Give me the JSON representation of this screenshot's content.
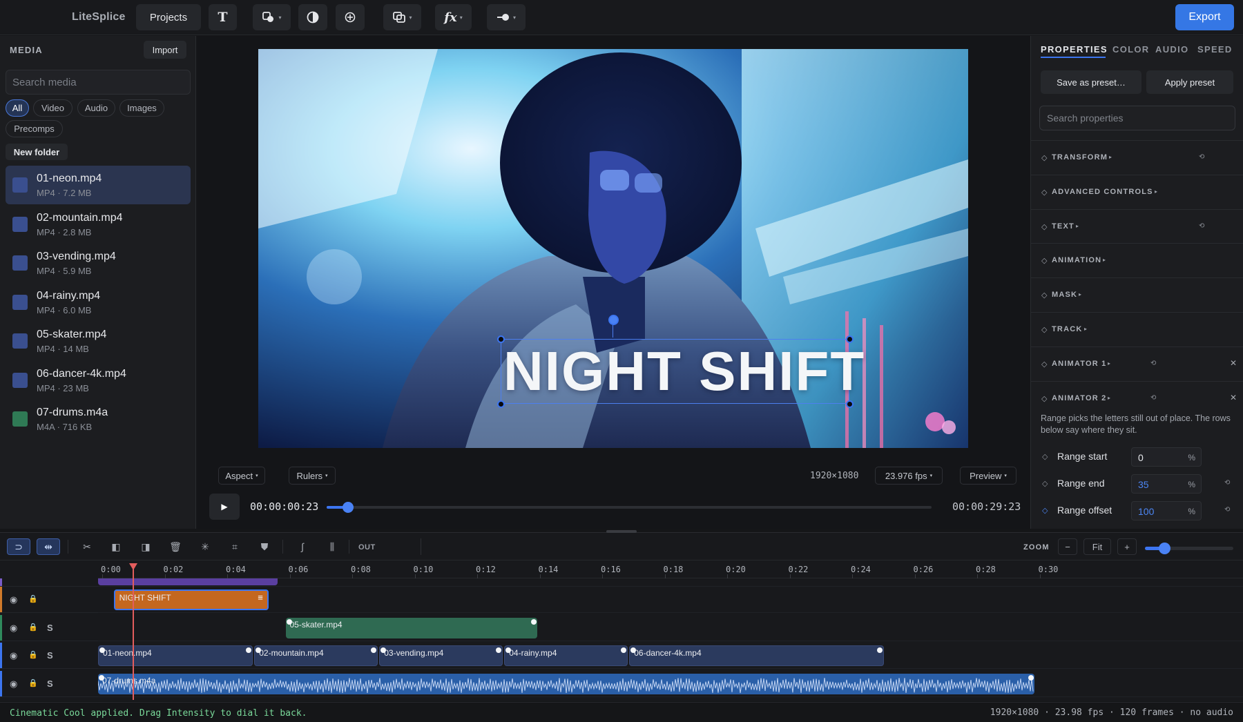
{
  "app": {
    "title": "LiteSplice"
  },
  "toolbar": {
    "projects_label": "Projects",
    "text_icon": "T",
    "fx_icon": "fx",
    "export_label": "Export"
  },
  "media": {
    "title": "MEDIA",
    "import_label": "Import",
    "search_placeholder": "Search media",
    "filters": [
      "All",
      "Video",
      "Audio",
      "Images",
      "Precomps"
    ],
    "active_filter": "All",
    "new_folder_label": "New folder",
    "items": [
      {
        "name": "01-neon.mp4",
        "meta": "MP4 · 7.2 MB",
        "color": "#3a4f8f"
      },
      {
        "name": "02-mountain.mp4",
        "meta": "MP4 · 2.8 MB",
        "color": "#3a4f8f"
      },
      {
        "name": "03-vending.mp4",
        "meta": "MP4 · 5.9 MB",
        "color": "#3a4f8f"
      },
      {
        "name": "04-rainy.mp4",
        "meta": "MP4 · 6.0 MB",
        "color": "#3a4f8f"
      },
      {
        "name": "05-skater.mp4",
        "meta": "MP4 · 14 MB",
        "color": "#3a4f8f"
      },
      {
        "name": "06-dancer-4k.mp4",
        "meta": "MP4 · 23 MB",
        "color": "#3a4f8f"
      },
      {
        "name": "07-drums.m4a",
        "meta": "M4A · 716 KB",
        "color": "#2f7a55"
      }
    ]
  },
  "viewer": {
    "overlay_text": "NIGHT SHIFT",
    "aspect_label": "Aspect",
    "rulers_label": "Rulers",
    "resolution": "1920×1080",
    "fps_label": "23.976 fps",
    "preview_label": "Preview",
    "timecode_current": "00:00:00:23",
    "timecode_total": "00:00:29:23",
    "scrub_progress": 0.035
  },
  "properties": {
    "tabs": [
      "PROPERTIES",
      "COLOR",
      "AUDIO",
      "SPEED"
    ],
    "active_tab": "PROPERTIES",
    "save_preset_label": "Save as preset…",
    "apply_preset_label": "Apply preset",
    "search_placeholder": "Search properties",
    "sections": [
      {
        "title": "TRANSFORM",
        "reset": true,
        "close": false
      },
      {
        "title": "ADVANCED CONTROLS",
        "reset": false,
        "close": false
      },
      {
        "title": "TEXT",
        "reset": true,
        "close": false
      },
      {
        "title": "ANIMATION",
        "reset": false,
        "close": false
      },
      {
        "title": "MASK",
        "reset": false,
        "close": false
      },
      {
        "title": "TRACK",
        "reset": false,
        "close": false
      },
      {
        "title": "ANIMATOR 1",
        "reset": true,
        "close": true
      },
      {
        "title": "ANIMATOR 2",
        "reset": true,
        "close": true
      }
    ],
    "animator_description": "Range picks the letters still out of place. The rows below say where they sit.",
    "range": [
      {
        "label": "Range start",
        "value": "0",
        "unit": "%"
      },
      {
        "label": "Range end",
        "value": "35",
        "unit": "%"
      },
      {
        "label": "Range offset",
        "value": "100",
        "unit": "%"
      }
    ]
  },
  "timeline": {
    "out_label": "OUT",
    "zoom_label": "ZOOM",
    "zoom_minus": "−",
    "zoom_fit": "Fit",
    "zoom_plus": "+",
    "zoom_level": 0.22,
    "ruler_ticks": [
      "0:00",
      "0:02",
      "0:04",
      "0:06",
      "0:08",
      "0:10",
      "0:12",
      "0:14",
      "0:16",
      "0:18",
      "0:20",
      "0:22",
      "0:24",
      "0:26",
      "0:28",
      "0:30"
    ],
    "solo_label": "S",
    "tracks": [
      {
        "clips": [
          {
            "label": "NIGHT SHIFT",
            "color": "#c4671f"
          }
        ]
      },
      {
        "clips": [
          {
            "label": "05-skater.mp4",
            "color": "#2f6a52"
          }
        ]
      },
      {
        "clips": [
          {
            "label": "01-neon.mp4"
          },
          {
            "label": "02-mountain.mp4"
          },
          {
            "label": "03-vending.mp4"
          },
          {
            "label": "04-rainy.mp4"
          },
          {
            "label": "06-dancer-4k.mp4"
          }
        ]
      },
      {
        "clips": [
          {
            "label": "07-drums.m4a"
          }
        ]
      }
    ]
  },
  "status": {
    "message": "Cinematic Cool applied. Drag Intensity to dial it back.",
    "info": "1920×1080 · 23.98 fps · 120 frames · no audio"
  },
  "colors": {
    "accent": "#3c75f0",
    "orange_clip": "#c4671f",
    "green_clip": "#2f6a52",
    "video_clip": "#2b3a5e",
    "audio_clip": "#2a5fa8",
    "status_green": "#7ad99a"
  }
}
